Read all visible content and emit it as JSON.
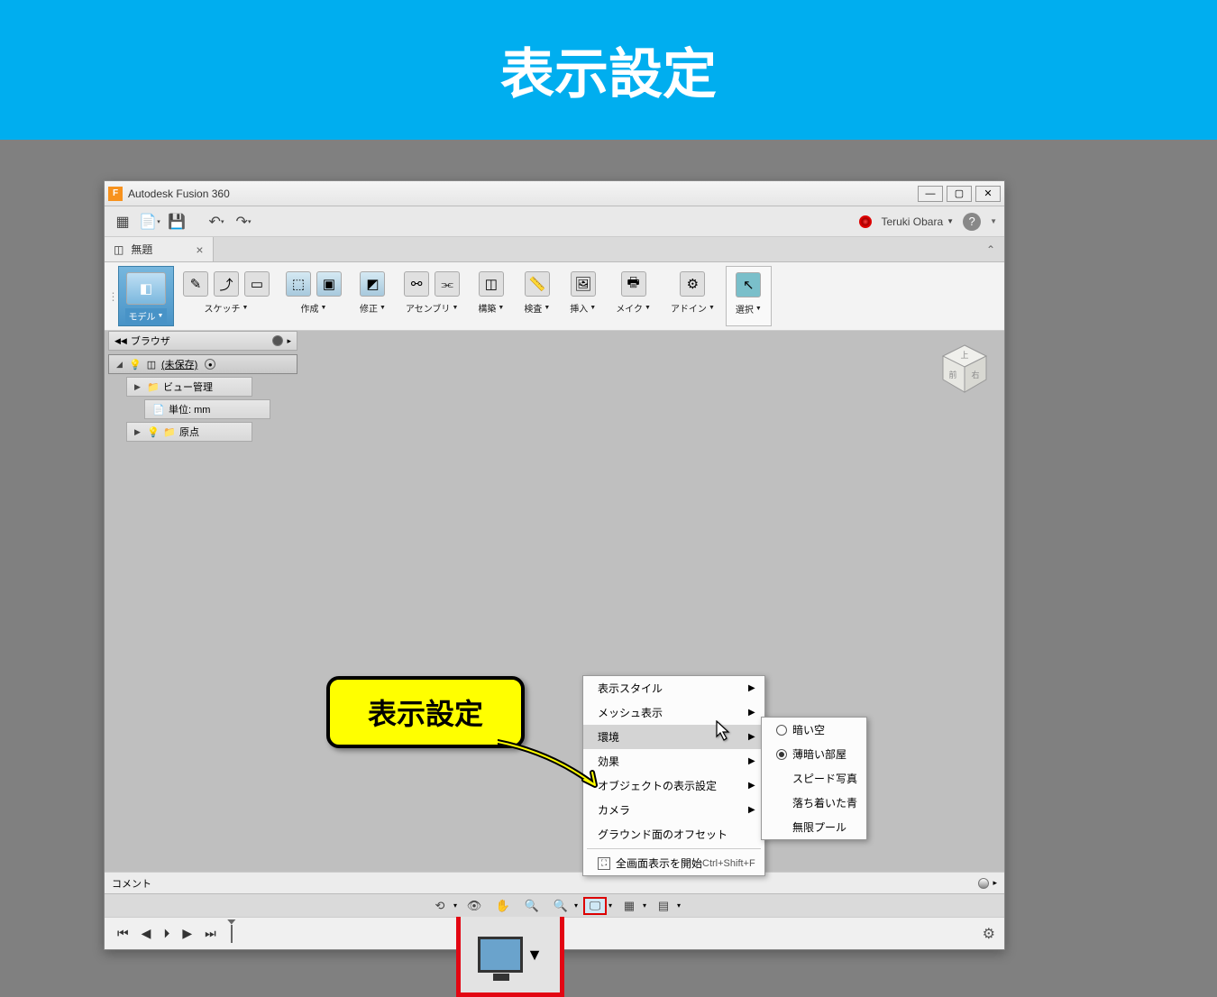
{
  "banner_title": "表示設定",
  "app_title": "Autodesk Fusion 360",
  "user_name": "Teruki Obara",
  "doc_tab": "無題",
  "ribbon": {
    "model": "モデル",
    "sketch": "スケッチ",
    "create": "作成",
    "modify": "修正",
    "assembly": "アセンブリ",
    "construct": "構築",
    "inspect": "検査",
    "insert": "挿入",
    "make": "メイク",
    "addin": "アドイン",
    "select": "選択"
  },
  "browser": {
    "title": "ブラウザ",
    "root": "(未保存)",
    "view_manage": "ビュー管理",
    "units": "単位: mm",
    "origin": "原点"
  },
  "comment_label": "コメント",
  "context_menu": {
    "display_style": "表示スタイル",
    "mesh_display": "メッシュ表示",
    "environment": "環境",
    "effects": "効果",
    "object_display": "オブジェクトの表示設定",
    "camera": "カメラ",
    "ground_offset": "グラウンド面のオフセット",
    "fullscreen": "全画面表示を開始",
    "fullscreen_shortcut": "Ctrl+Shift+F"
  },
  "submenu": {
    "dark_sky": "暗い空",
    "dim_room": "薄暗い部屋",
    "speed_photo": "スピード写真",
    "calm_blue": "落ち着いた青",
    "infinite_pool": "無限プール"
  },
  "callout_label": "表示設定",
  "viewcube": {
    "top": "上",
    "front": "前",
    "right": "右"
  }
}
